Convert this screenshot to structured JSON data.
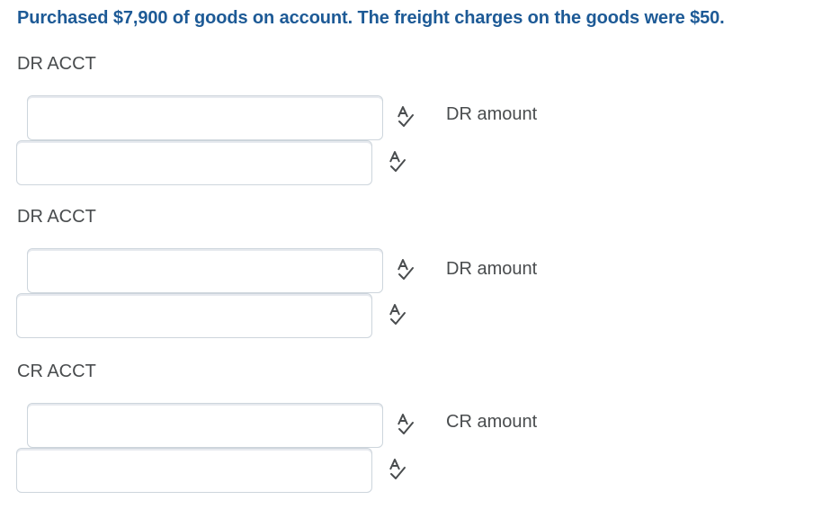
{
  "question": "Purchased $7,900 of goods on account. The freight charges on the goods were $50.",
  "entries": [
    {
      "account_label": "DR ACCT",
      "amount_label": "DR amount",
      "account_value": "",
      "amount_value": "",
      "spellcheck_icon": "spellcheck-icon"
    },
    {
      "account_label": "DR ACCT",
      "amount_label": "DR amount",
      "account_value": "",
      "amount_value": "",
      "spellcheck_icon": "spellcheck-icon"
    },
    {
      "account_label": "CR ACCT",
      "amount_label": "CR amount",
      "account_value": "",
      "amount_value": "",
      "spellcheck_icon": "spellcheck-icon"
    }
  ],
  "colors": {
    "question_text": "#1d5a96",
    "body_text": "#494c4e",
    "field_border": "#cdd5dc"
  }
}
